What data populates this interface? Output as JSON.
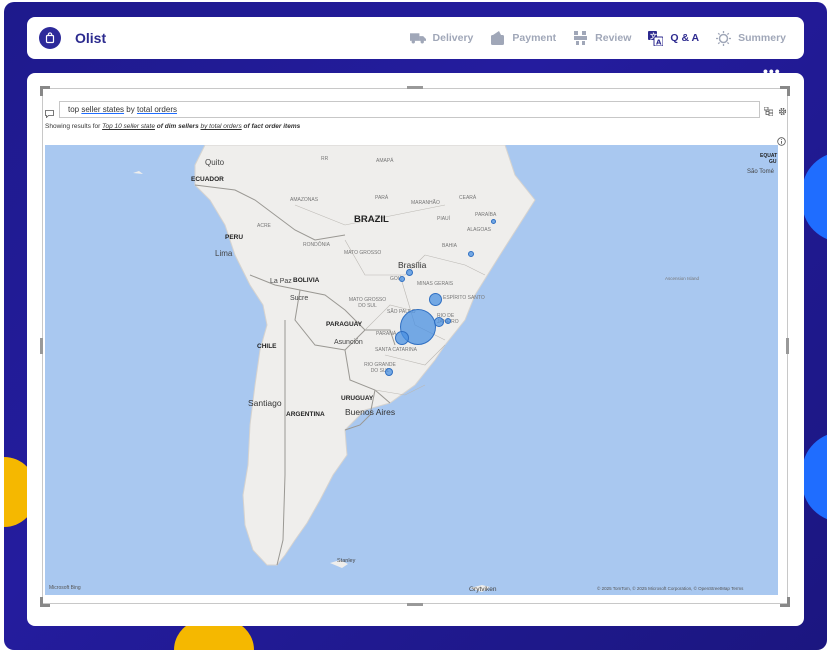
{
  "app": {
    "brand": "Olist"
  },
  "nav": [
    {
      "label": "Delivery",
      "icon": "truck-icon",
      "active": false
    },
    {
      "label": "Payment",
      "icon": "wallet-icon",
      "active": false
    },
    {
      "label": "Review",
      "icon": "review-icon",
      "active": false
    },
    {
      "label": "Q & A",
      "icon": "translate-icon",
      "active": true
    },
    {
      "label": "Summery",
      "icon": "lightbulb-icon",
      "active": false
    }
  ],
  "qa": {
    "query_part1": "top",
    "query_part2": "seller states",
    "query_part3": "by",
    "query_part4": "total orders",
    "showing_prefix": "Showing results for",
    "showing_t1": "Top 10 seller state",
    "showing_t2": "of dim sellers",
    "showing_t3": "by total orders",
    "showing_t4": "of fact order items"
  },
  "map": {
    "labels": {
      "quito": "Quito",
      "ecuador": "ECUADOR",
      "peru": "PERU",
      "lima": "Lima",
      "brazil": "BRAZIL",
      "bolivia": "BOLIVIA",
      "la_paz": "La Paz",
      "sucre": "Sucre",
      "paraguay": "PARAGUAY",
      "asuncion": "Asunción",
      "chile": "CHILE",
      "santiago": "Santiago",
      "argentina": "ARGENTINA",
      "uruguay": "URUGUAY",
      "buenos_aires": "Buenos Aires",
      "brasilia": "Brasília",
      "stanley": "Stanley",
      "grytviken": "Grytviken",
      "sao_tome": "São Tomé",
      "equatorial": "EQUAT",
      "gu": "GU",
      "amazonas": "AMAZONAS",
      "para": "PARÁ",
      "rr": "RR",
      "amapa": "AMAPÁ",
      "maranhao": "MARANHÃO",
      "ceara": "CEARÁ",
      "paraiba": "PARAÍBA",
      "piaui": "PIAUÍ",
      "alagoas": "ALAGOAS",
      "acre": "ACRE",
      "rondonia": "RONDÔNIA",
      "mato_grosso": "MATO GROSSO",
      "bahia": "BAHIA",
      "goias": "GOI",
      "minas_gerais": "MINAS GERAIS",
      "mato_grosso_sul": "MATO GROSSO DO SUL",
      "espirito_santo": "ESPÍRITO SANTO",
      "sao_paulo": "SÃO PAULO",
      "rio_de_janeiro": "RIO DE JANEIRO",
      "parana": "PARANÁ",
      "santa_catarina": "SANTA CATARINA",
      "rio_grande_sul": "RIO GRANDE DO SUL",
      "ascension": "Ascension Island"
    },
    "attribution": "© 2025 TomTom, © 2025 Microsoft Corporation, © OpenStreetMap Terms",
    "logo": "Microsoft Bing"
  },
  "colors": {
    "accent": "#2d2a9a",
    "bubble": "#4a90e2",
    "ocean": "#a9c8f0",
    "land": "#efeeec"
  }
}
